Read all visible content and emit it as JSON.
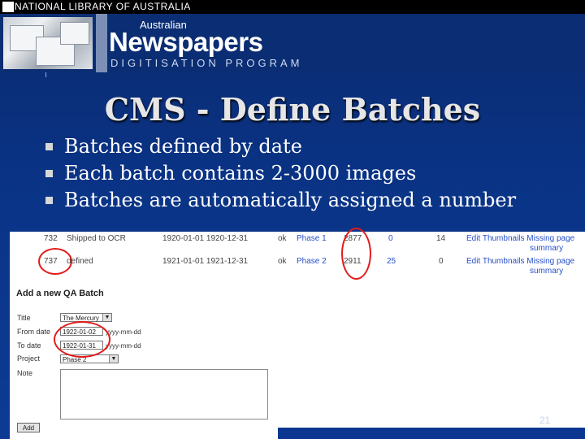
{
  "header": {
    "top_label": "NATIONAL LIBRARY OF AUSTRALIA",
    "banner_small": "Australian",
    "banner_big": "Newspapers",
    "banner_program": "DIGITISATION PROGRAM"
  },
  "slide": {
    "title": "CMS - Define Batches",
    "bullets": [
      "Batches defined by date",
      "Each batch contains 2-3000 images",
      "Batches are automatically assigned a number"
    ],
    "page_number": "21"
  },
  "batch_table": {
    "rows": [
      {
        "id": "732",
        "status": "Shipped to OCR",
        "dates": "1920-01-01 1920-12-31",
        "ok": "ok",
        "phase": "Phase 1",
        "images": "2877",
        "c1": "0",
        "c2": "14",
        "actions1": "Edit Thumbnails Missing page",
        "actions2": "summary"
      },
      {
        "id": "737",
        "status": "defined",
        "dates": "1921-01-01 1921-12-31",
        "ok": "ok",
        "phase": "Phase 2",
        "images": "2911",
        "c1": "25",
        "c2": "0",
        "actions1": "Edit Thumbnails Missing page",
        "actions2": "summary"
      }
    ]
  },
  "qa_form": {
    "heading": "Add a new QA Batch",
    "title_label": "Title",
    "title_value": "The Mercury",
    "from_label": "From date",
    "from_value": "1922-01-02",
    "from_hint": "yyyy-mm-dd",
    "to_label": "To date",
    "to_value": "1922-01-31",
    "to_hint": "yyyy-mm-dd",
    "project_label": "Project",
    "project_value": "Phase 2",
    "note_label": "Note",
    "add_label": "Add"
  },
  "colors": {
    "slide_bg": "#0a3385",
    "annotation": "#e21b1b",
    "link": "#2850c8"
  }
}
